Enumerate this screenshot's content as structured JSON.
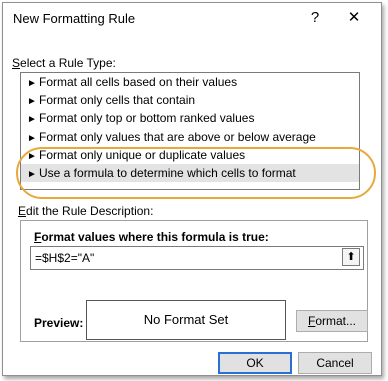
{
  "window": {
    "title": "New Formatting Rule",
    "help_label": "?",
    "close_label": "✕"
  },
  "rule_type": {
    "label_prefix": "S",
    "label_rest": "elect a Rule Type:",
    "items": [
      {
        "label": "Format all cells based on their values"
      },
      {
        "label": "Format only cells that contain"
      },
      {
        "label": "Format only top or bottom ranked values"
      },
      {
        "label": "Format only values that are above or below average"
      },
      {
        "label": "Format only unique or duplicate values"
      },
      {
        "label": "Use a formula to determine which cells to format"
      }
    ],
    "selected_index": 5
  },
  "description": {
    "label_prefix": "E",
    "label_rest": "dit the Rule Description:",
    "formula_heading_prefix": "F",
    "formula_heading_rest": "ormat values where this formula is true:",
    "formula_value": "=$H$2=\"A\"",
    "collapse_icon": "⬆"
  },
  "preview": {
    "label": "Preview:",
    "text": "No Format Set"
  },
  "buttons": {
    "format_prefix": "F",
    "format_rest": "ormat...",
    "ok": "OK",
    "cancel": "Cancel"
  },
  "colors": {
    "highlight_oval": "#e8a93b",
    "ok_border": "#2a6fd6",
    "selected_item_bg": "#e3e3e3"
  }
}
